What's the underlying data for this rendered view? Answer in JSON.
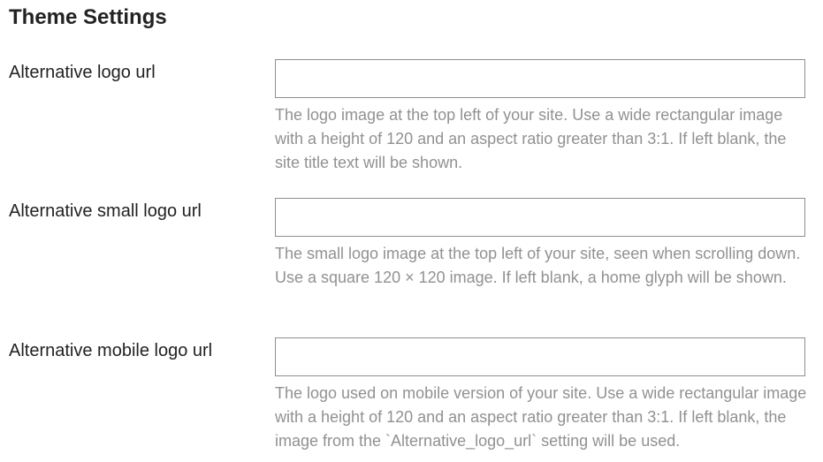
{
  "page": {
    "title": "Theme Settings"
  },
  "settings": [
    {
      "label": "Alternative logo url",
      "value": "",
      "description": "The logo image at the top left of your site. Use a wide rectangular image with a height of 120 and an aspect ratio greater than 3:1. If left blank, the site title text will be shown."
    },
    {
      "label": "Alternative small logo url",
      "value": "",
      "description": "The small logo image at the top left of your site, seen when scrolling down. Use a square 120 × 120 image. If left blank, a home glyph will be shown."
    },
    {
      "label": "Alternative mobile logo url",
      "value": "",
      "description": "The logo used on mobile version of your site. Use a wide rectangular image with a height of 120 and an aspect ratio greater than 3:1. If left blank, the image from the `Alternative_logo_url` setting will be used."
    }
  ]
}
